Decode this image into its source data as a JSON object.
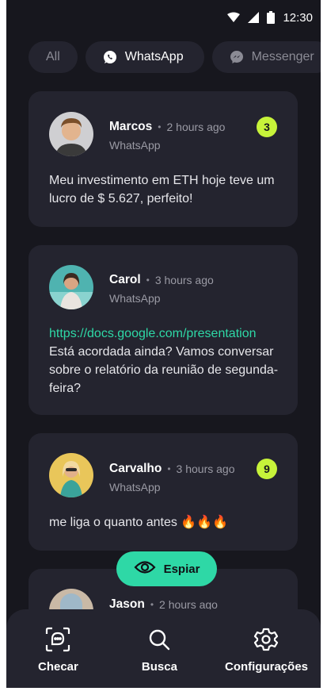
{
  "status_bar": {
    "time": "12:30",
    "wifi_icon": "wifi-icon",
    "signal_icon": "signal-icon",
    "battery_icon": "battery-icon"
  },
  "filters": [
    {
      "label": "All",
      "icon": ""
    },
    {
      "label": "WhatsApp",
      "icon": "whatsapp-icon"
    },
    {
      "label": "Messenger",
      "icon": "messenger-icon"
    }
  ],
  "active_filter": "WhatsApp",
  "messages": [
    {
      "name": "Marcos",
      "time": "2 hours ago",
      "source": "WhatsApp",
      "badge": "3",
      "link": "",
      "text": "Meu investimento em ETH hoje teve um lucro de $ 5.627, perfeito!"
    },
    {
      "name": "Carol",
      "time": "3 hours ago",
      "source": "WhatsApp",
      "badge": "",
      "link": "https://docs.google.com/presentation",
      "text": "Está acordada ainda? Vamos conversar sobre o relatório da reunião de segunda-feira?"
    },
    {
      "name": "Carvalho",
      "time": "3 hours ago",
      "source": "WhatsApp",
      "badge": "9",
      "link": "",
      "text": "me liga o quanto antes 🔥🔥🔥"
    },
    {
      "name": "Jason",
      "time": "2 hours ago",
      "source": "",
      "badge": "",
      "link": "",
      "text": ""
    }
  ],
  "separator": "•",
  "spy_button": {
    "label": "Espiar",
    "icon": "eye-icon"
  },
  "bottom_nav": [
    {
      "label": "Checar",
      "icon": "scan-chat-icon"
    },
    {
      "label": "Busca",
      "icon": "search-icon"
    },
    {
      "label": "Configurações",
      "icon": "gear-icon"
    }
  ],
  "colors": {
    "background": "#17171e",
    "card": "#24242f",
    "accent": "#2ed8a6",
    "badge": "#c7f33a"
  }
}
